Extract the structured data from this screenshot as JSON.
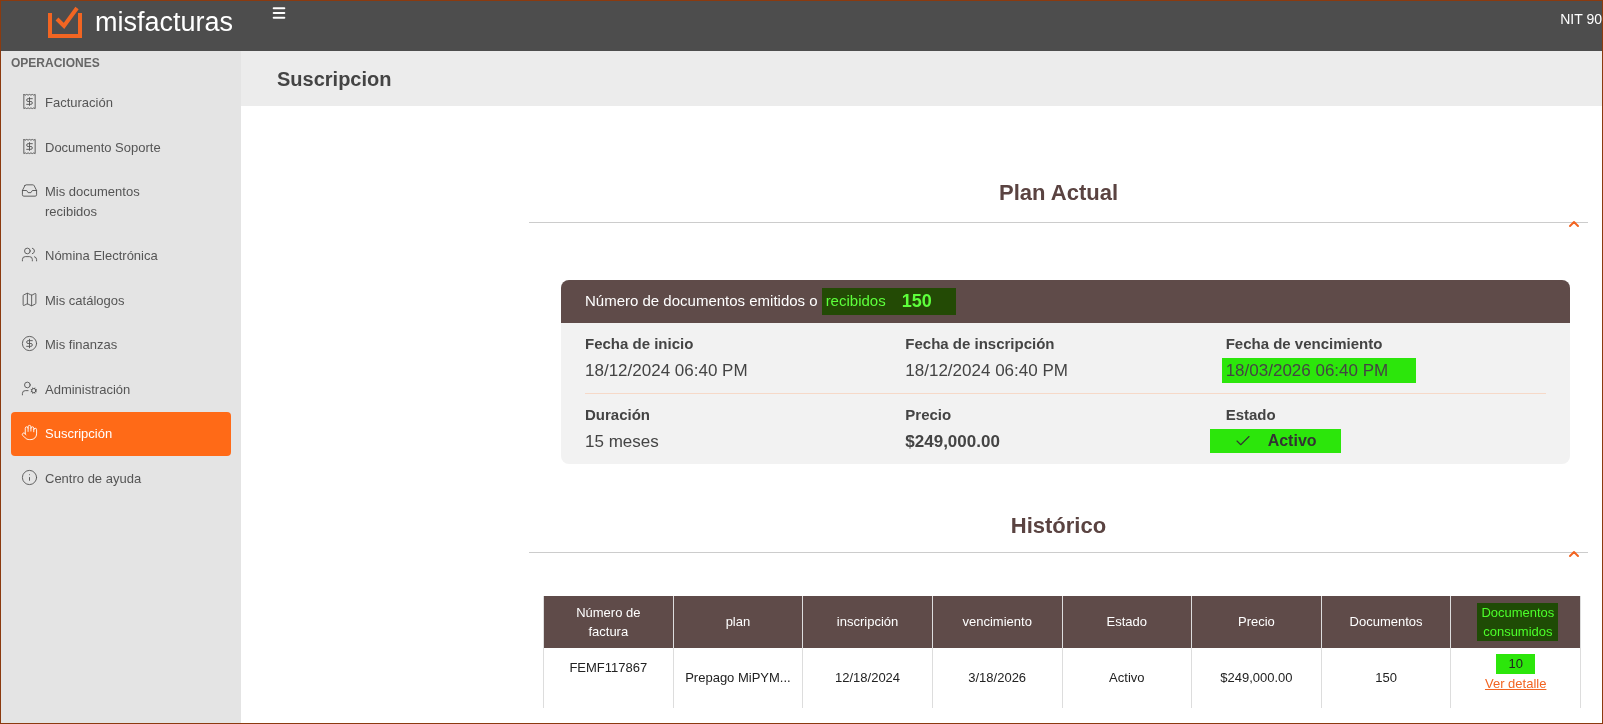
{
  "header": {
    "logo_text": "misfacturas",
    "nit": "NIT 90"
  },
  "sidebar": {
    "section": "OPERACIONES",
    "items": [
      {
        "label": "Facturación",
        "kind": "receipt",
        "selected": false
      },
      {
        "label": "Documento Soporte",
        "kind": "receipt",
        "selected": false
      },
      {
        "label": "Mis documentos recibidos",
        "kind": "inbox",
        "selected": false
      },
      {
        "label": "Nómina Electrónica",
        "kind": "users",
        "selected": false
      },
      {
        "label": "Mis catálogos",
        "kind": "map",
        "selected": false
      },
      {
        "label": "Mis finanzas",
        "kind": "dollar",
        "selected": false
      },
      {
        "label": "Administración",
        "kind": "admin",
        "selected": false
      },
      {
        "label": "Suscripción",
        "kind": "hand",
        "selected": true
      },
      {
        "label": "Centro de ayuda",
        "kind": "info",
        "selected": false
      }
    ]
  },
  "page_title": "Suscripcion",
  "plan": {
    "heading": "Plan Actual",
    "summary": "Número de documentos emitidos o",
    "summary_highlight": "recibidos",
    "count": "150",
    "fields": [
      {
        "label": "Fecha de inicio",
        "value": "18/12/2024 06:40 PM",
        "kind": "plain"
      },
      {
        "label": "Fecha de inscripción",
        "value": "18/12/2024 06:40 PM",
        "kind": "plain"
      },
      {
        "label": "Fecha de vencimiento",
        "value": "18/03/2026 06:40 PM",
        "kind": "highlight"
      },
      {
        "label": "Duración",
        "value": "15 meses",
        "kind": "plain"
      },
      {
        "label": "Precio",
        "value": "$249,000.00",
        "kind": "bold"
      },
      {
        "label": "Estado",
        "value": "Activo",
        "kind": "status"
      }
    ]
  },
  "history": {
    "heading": "Histórico",
    "columns": [
      "Número de factura",
      "plan",
      "inscripción",
      "vencimiento",
      "Estado",
      "Precio",
      "Documentos",
      "Documentos consumidos"
    ],
    "rows": [
      {
        "cells": [
          "FEMF117867",
          "Prepago MiPYM...",
          "12/18/2024",
          "3/18/2026",
          "Activo",
          "$249,000.00",
          "150",
          "10"
        ],
        "link": "Ver detalle"
      }
    ]
  }
}
